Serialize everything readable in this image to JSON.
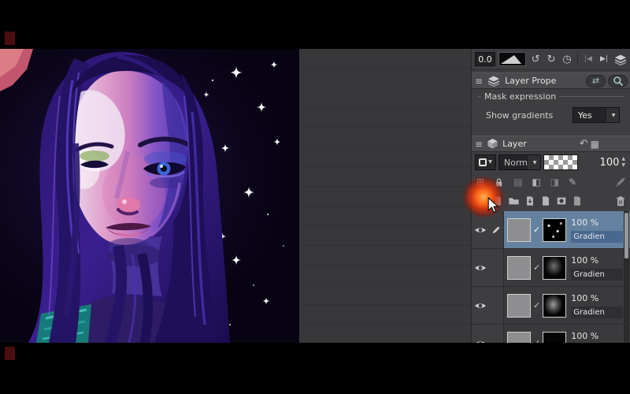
{
  "ui": {
    "selection_color": "#64819f",
    "glow_color": "#ff6a1a"
  },
  "toolbar": {
    "value": "0.0",
    "undo_icon": "↺",
    "redo_icon": "↻",
    "history_icon": "◷",
    "jump_back_icon": "|◀",
    "jump_forward_icon": "▶|"
  },
  "layer_properties": {
    "menu_icon": "≡",
    "title": "Layer Prope",
    "swap_icon": "⇄",
    "group_label": "Mask expression",
    "show_gradients_label": "Show gradients",
    "show_gradients_value": "Yes",
    "dropdown_arrow": "▼"
  },
  "layer_panel": {
    "menu_icon": "≡",
    "title": "Layer",
    "undo_icon": "↶",
    "grid_icon": "▦",
    "blend_mode": "Norm",
    "dropdown_arrow": "▼",
    "opacity_value": "100",
    "spinner_up": "▲",
    "spinner_down": "▼",
    "checkmark": "✓",
    "tool_icons": [
      "⊞",
      "▤",
      "◧",
      "◨",
      "✎"
    ]
  },
  "layers": [
    {
      "opacity": "100 %",
      "name": "Gradien",
      "selected": "true"
    },
    {
      "opacity": "100 %",
      "name": "Gradien",
      "selected": "false"
    },
    {
      "opacity": "100 %",
      "name": "Gradien",
      "selected": "false"
    },
    {
      "opacity": "100 %",
      "name": "",
      "selected": "false"
    }
  ]
}
